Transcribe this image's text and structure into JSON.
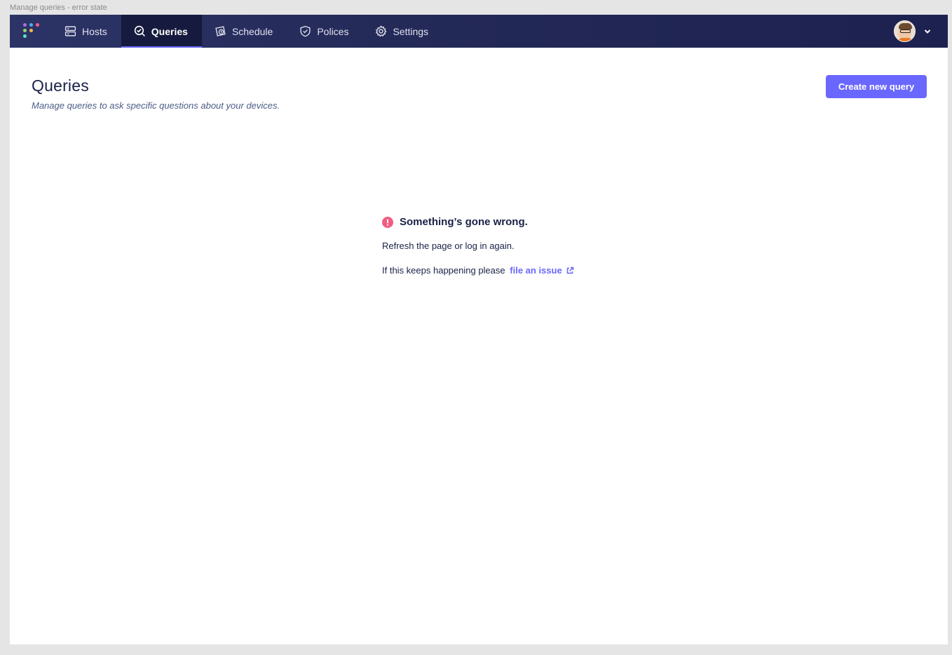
{
  "frame": {
    "label": "Manage queries - error state"
  },
  "nav": {
    "items": [
      {
        "label": "Hosts",
        "icon": "hosts-icon",
        "active": false
      },
      {
        "label": "Queries",
        "icon": "queries-icon",
        "active": true
      },
      {
        "label": "Schedule",
        "icon": "schedule-icon",
        "active": false
      },
      {
        "label": "Polices",
        "icon": "policies-icon",
        "active": false
      },
      {
        "label": "Settings",
        "icon": "settings-icon",
        "active": false
      }
    ],
    "logo_colors": [
      "#ff5c83",
      "#54aee8",
      "#9bd56d",
      "#ae6ddf",
      "#f7b84c",
      "#5ee6c1"
    ]
  },
  "header": {
    "title": "Queries",
    "subtitle": "Manage queries to ask specific questions about your devices.",
    "create_button": "Create new query"
  },
  "error": {
    "heading": "Something’s gone wrong.",
    "line1": "Refresh the page or log in again.",
    "line2_prefix": "If this keeps happening please",
    "link_label": "file an issue",
    "icon": "alert-icon",
    "color": "#f25c80"
  },
  "theme": {
    "accent": "#6a67fe",
    "nav_bg": "#242a58",
    "text": "#192147"
  }
}
